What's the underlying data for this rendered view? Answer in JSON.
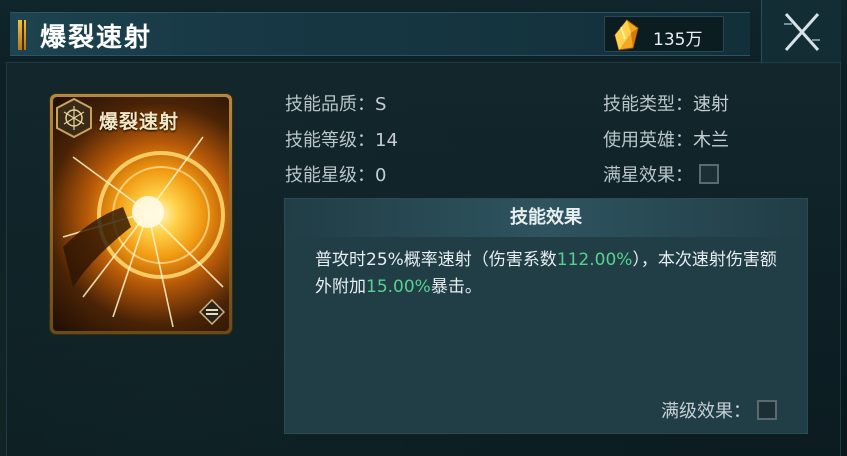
{
  "header": {
    "title": "爆裂速射",
    "currency_value": "135万",
    "close_icon": "close-x-icon",
    "currency_icon": "crystal-icon"
  },
  "card": {
    "name": "爆裂速射"
  },
  "skill_info": {
    "quality_label": "技能品质：",
    "quality_value": "S",
    "level_label": "技能等级：",
    "level_value": "14",
    "star_label": "技能星级：",
    "star_value": "0",
    "type_label": "技能类型：",
    "type_value": "速射",
    "hero_label": "使用英雄：",
    "hero_value": "木兰",
    "full_star_label": "满星效果："
  },
  "effect": {
    "title": "技能效果",
    "text_part1": "普攻时25%概率速射（伤害系数",
    "text_hl1": "112.00%",
    "text_part2": "），本次速射伤害额外附加",
    "text_hl2": "15.00%",
    "text_part3": "暴击。",
    "max_level_label": "满级效果："
  },
  "colors": {
    "highlight": "#56d28e",
    "accent_gold": "#f0c23a"
  }
}
